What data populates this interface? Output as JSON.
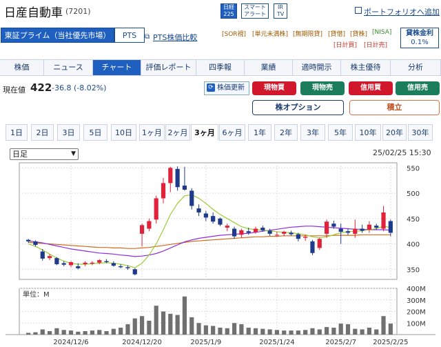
{
  "header": {
    "title": "日産自動車",
    "code": "(7201)",
    "icons": [
      {
        "line1": "日経",
        "line2": "225"
      },
      {
        "line1": "スマート",
        "line2": "アラート"
      },
      {
        "line1": "IR",
        "line2": "TV"
      }
    ],
    "portfolio_link": "ポートフォリオへ追加"
  },
  "market": {
    "selected": "東証プライム（当社優先市場）",
    "pts_tab": "PTS",
    "pts_compare": "PTS株価比較"
  },
  "tags_row1": [
    "[SOR視]",
    "[単元未満株]",
    "[無期限貸]",
    "[貸借]",
    "[貸株]",
    "[NISA]"
  ],
  "tags_row2": [
    "[日計買]",
    "[日計売]"
  ],
  "lending": {
    "label": "貸株金利",
    "rate": "0.1%"
  },
  "nav_tabs": [
    "株価",
    "ニュース",
    "チャート",
    "評価レポート",
    "四季報",
    "業績",
    "適時開示",
    "株主優待",
    "分析"
  ],
  "quote": {
    "label": "現在値",
    "price": "422",
    "change": "-36.8 (-8.02%)",
    "update_button": "株価更新"
  },
  "trade_buttons": {
    "spot_buy": "現物買",
    "spot_sell": "現物売",
    "margin_buy": "信用買",
    "margin_sell": "信用売",
    "options": "株オプション",
    "savings": "積立"
  },
  "periods": [
    "1日",
    "2日",
    "3日",
    "5日",
    "10日",
    "1ヶ月",
    "2ヶ月",
    "3ヶ月",
    "6ヶ月",
    "1年",
    "2年",
    "3年",
    "5年",
    "10年",
    "20年",
    "30年"
  ],
  "period_active": "3ヶ月",
  "chart_controls": {
    "interval": "日足",
    "timestamp": "25/02/25 15:30"
  },
  "colors": {
    "accent": "#1f5fbf",
    "up": "#e0223a",
    "down": "#1e3a8a",
    "ma_short": "#9acd32",
    "ma_mid": "#8a2be2",
    "ma_long": "#d2691e"
  },
  "chart_data": {
    "type": "candlestick",
    "price_axis": {
      "min": 330,
      "max": 560,
      "ticks": [
        "550",
        "500",
        "450",
        "400",
        "350"
      ]
    },
    "volume_axis": {
      "unit_label": "単位：M",
      "ticks": [
        "400M",
        "300M",
        "200M",
        "100M"
      ],
      "max": 400
    },
    "x_labels": [
      "2024/12/6",
      "2024/12/20",
      "2025/1/9",
      "2025/1/24",
      "2025/2/7",
      "2025/2/25"
    ],
    "candles": [
      {
        "o": 408,
        "h": 410,
        "l": 402,
        "c": 405
      },
      {
        "o": 405,
        "h": 407,
        "l": 395,
        "c": 398
      },
      {
        "o": 385,
        "h": 390,
        "l": 367,
        "c": 371
      },
      {
        "o": 372,
        "h": 380,
        "l": 368,
        "c": 376
      },
      {
        "o": 372,
        "h": 374,
        "l": 358,
        "c": 360
      },
      {
        "o": 362,
        "h": 366,
        "l": 356,
        "c": 359
      },
      {
        "o": 358,
        "h": 366,
        "l": 354,
        "c": 364
      },
      {
        "o": 356,
        "h": 362,
        "l": 350,
        "c": 352
      },
      {
        "o": 360,
        "h": 366,
        "l": 356,
        "c": 363
      },
      {
        "o": 361,
        "h": 366,
        "l": 358,
        "c": 363
      },
      {
        "o": 363,
        "h": 370,
        "l": 360,
        "c": 368
      },
      {
        "o": 366,
        "h": 370,
        "l": 362,
        "c": 364
      },
      {
        "o": 362,
        "h": 366,
        "l": 355,
        "c": 357
      },
      {
        "o": 356,
        "h": 360,
        "l": 352,
        "c": 354
      },
      {
        "o": 354,
        "h": 358,
        "l": 349,
        "c": 352
      },
      {
        "o": 350,
        "h": 352,
        "l": 338,
        "c": 340
      },
      {
        "o": 420,
        "h": 440,
        "l": 395,
        "c": 437
      },
      {
        "o": 430,
        "h": 450,
        "l": 425,
        "c": 445
      },
      {
        "o": 448,
        "h": 495,
        "l": 440,
        "c": 490
      },
      {
        "o": 490,
        "h": 530,
        "l": 480,
        "c": 520
      },
      {
        "o": 520,
        "h": 552,
        "l": 502,
        "c": 550
      },
      {
        "o": 548,
        "h": 553,
        "l": 505,
        "c": 512
      },
      {
        "o": 515,
        "h": 552,
        "l": 505,
        "c": 507
      },
      {
        "o": 505,
        "h": 510,
        "l": 468,
        "c": 475
      },
      {
        "o": 470,
        "h": 478,
        "l": 455,
        "c": 462
      },
      {
        "o": 460,
        "h": 465,
        "l": 445,
        "c": 452
      },
      {
        "o": 455,
        "h": 462,
        "l": 440,
        "c": 444
      },
      {
        "o": 450,
        "h": 452,
        "l": 435,
        "c": 438
      },
      {
        "o": 432,
        "h": 440,
        "l": 425,
        "c": 436
      },
      {
        "o": 430,
        "h": 434,
        "l": 410,
        "c": 415
      },
      {
        "o": 418,
        "h": 430,
        "l": 412,
        "c": 427
      },
      {
        "o": 425,
        "h": 432,
        "l": 418,
        "c": 422
      },
      {
        "o": 423,
        "h": 434,
        "l": 420,
        "c": 430
      },
      {
        "o": 432,
        "h": 436,
        "l": 424,
        "c": 427
      },
      {
        "o": 426,
        "h": 430,
        "l": 416,
        "c": 420
      },
      {
        "o": 418,
        "h": 424,
        "l": 414,
        "c": 418
      },
      {
        "o": 420,
        "h": 426,
        "l": 415,
        "c": 424
      },
      {
        "o": 422,
        "h": 426,
        "l": 416,
        "c": 419
      },
      {
        "o": 419,
        "h": 422,
        "l": 405,
        "c": 410
      },
      {
        "o": 412,
        "h": 418,
        "l": 406,
        "c": 414
      },
      {
        "o": 405,
        "h": 408,
        "l": 378,
        "c": 382
      },
      {
        "o": 392,
        "h": 412,
        "l": 388,
        "c": 410
      },
      {
        "o": 420,
        "h": 448,
        "l": 412,
        "c": 444
      },
      {
        "o": 440,
        "h": 446,
        "l": 430,
        "c": 434
      },
      {
        "o": 430,
        "h": 440,
        "l": 400,
        "c": 424
      },
      {
        "o": 425,
        "h": 430,
        "l": 418,
        "c": 422
      },
      {
        "o": 420,
        "h": 448,
        "l": 412,
        "c": 430
      },
      {
        "o": 430,
        "h": 438,
        "l": 422,
        "c": 426
      },
      {
        "o": 428,
        "h": 445,
        "l": 422,
        "c": 438
      },
      {
        "o": 436,
        "h": 440,
        "l": 428,
        "c": 432
      },
      {
        "o": 430,
        "h": 475,
        "l": 425,
        "c": 462
      },
      {
        "o": 445,
        "h": 448,
        "l": 415,
        "c": 422
      }
    ],
    "volumes": [
      15,
      20,
      45,
      30,
      55,
      40,
      35,
      25,
      30,
      35,
      40,
      30,
      50,
      60,
      90,
      140,
      160,
      120,
      250,
      200,
      180,
      170,
      330,
      150,
      100,
      80,
      75,
      60,
      55,
      100,
      90,
      60,
      55,
      50,
      45,
      40,
      35,
      35,
      35,
      40,
      55,
      45,
      65,
      60,
      95,
      90,
      50,
      45,
      60,
      45,
      160,
      95
    ],
    "ma_short": [
      400,
      395,
      388,
      380,
      372,
      366,
      362,
      360,
      360,
      361,
      362,
      363,
      362,
      360,
      357,
      353,
      362,
      378,
      400,
      428,
      458,
      480,
      495,
      497,
      490,
      480,
      468,
      458,
      450,
      442,
      434,
      430,
      428,
      427,
      426,
      424,
      423,
      422,
      420,
      418,
      414,
      412,
      414,
      418,
      422,
      424,
      425,
      426,
      428,
      430,
      435,
      432
    ],
    "ma_mid": [
      406,
      404,
      402,
      399,
      396,
      393,
      390,
      388,
      386,
      384,
      382,
      381,
      380,
      378,
      377,
      375,
      376,
      378,
      381,
      386,
      392,
      398,
      404,
      408,
      411,
      413,
      415,
      417,
      418,
      419,
      420,
      421,
      423,
      425,
      427,
      429,
      431,
      433,
      434,
      435,
      435,
      434,
      433,
      432,
      431,
      430,
      429,
      429,
      428,
      428,
      428,
      427
    ],
    "ma_long": [
      403,
      402,
      401,
      400,
      399,
      398,
      397,
      396,
      395,
      394,
      393,
      393,
      392,
      392,
      391,
      391,
      392,
      393,
      395,
      397,
      399,
      401,
      403,
      405,
      406,
      407,
      408,
      409,
      410,
      411,
      412,
      413,
      414,
      414,
      415,
      415,
      416,
      416,
      416,
      416,
      416,
      416,
      416,
      417,
      417,
      417,
      417,
      418,
      418,
      418,
      418,
      418
    ]
  }
}
